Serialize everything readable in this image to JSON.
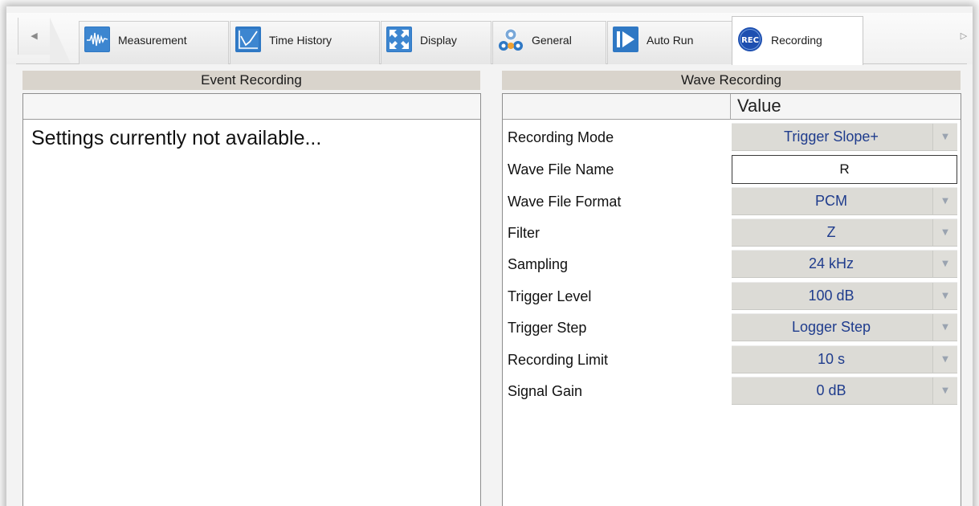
{
  "tabs": [
    {
      "label": "Measurement",
      "icon": "waveform-icon",
      "active": false
    },
    {
      "label": "Time History",
      "icon": "line-chart-icon",
      "active": false
    },
    {
      "label": "Display",
      "icon": "expand-arrows-icon",
      "active": false
    },
    {
      "label": "General",
      "icon": "gears-icon",
      "active": false
    },
    {
      "label": "Auto Run",
      "icon": "play-step-icon",
      "active": false
    },
    {
      "label": "Recording",
      "icon": "rec-icon",
      "icon_text": "REC",
      "active": true
    }
  ],
  "event_recording": {
    "title": "Event Recording",
    "message": "Settings currently not available..."
  },
  "wave_recording": {
    "title": "Wave Recording",
    "value_header": "Value",
    "rows": [
      {
        "name": "Recording Mode",
        "value": "Trigger Slope+",
        "type": "dropdown"
      },
      {
        "name": "Wave File Name",
        "value": "R",
        "type": "text"
      },
      {
        "name": "Wave File Format",
        "value": "PCM",
        "type": "dropdown"
      },
      {
        "name": "Filter",
        "value": "Z",
        "type": "dropdown"
      },
      {
        "name": "Sampling",
        "value": "24 kHz",
        "type": "dropdown"
      },
      {
        "name": "Trigger Level",
        "value": "100 dB",
        "type": "dropdown"
      },
      {
        "name": "Trigger Step",
        "value": "Logger Step",
        "type": "dropdown"
      },
      {
        "name": "Recording Limit",
        "value": "10 s",
        "type": "dropdown"
      },
      {
        "name": "Signal Gain",
        "value": "0 dB",
        "type": "dropdown"
      }
    ]
  },
  "colors": {
    "header_bg": "#d9d4cc",
    "value_text": "#1f3c8d",
    "icon_blue": "#2f78c4",
    "rec_blue": "#1d4fb0"
  }
}
